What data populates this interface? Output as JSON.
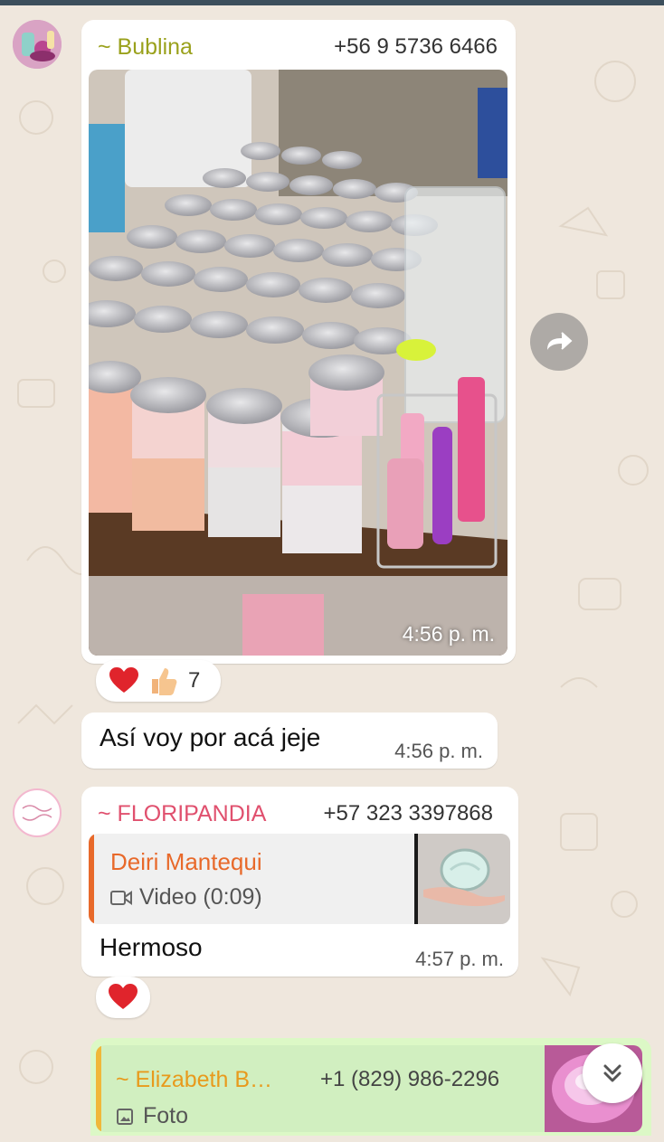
{
  "messages": [
    {
      "sender": "~ Bublina",
      "phone": "+56 9 5736 6466",
      "time": "4:56 p. m.",
      "reaction_count": "7"
    },
    {
      "text": "Así voy por acá jeje",
      "time": "4:56 p. m."
    },
    {
      "sender": "~ FLORIPANDIA",
      "phone": "+57 323 3397868",
      "quote_name": "Deiri Mantequi",
      "quote_text": "Video (0:09)",
      "text": "Hermoso",
      "time": "4:57 p. m."
    },
    {
      "quote_name": "~ Elizabeth B…",
      "quote_phone": "+1 (829) 986-2296",
      "quote_text": "Foto"
    }
  ],
  "avatars": {
    "floripandia_logo": "FloriPandia"
  },
  "colors": {
    "wallpaper": "#efe7dd",
    "bubline_name": "#9aa11c",
    "floripandia_name": "#e0506e",
    "quote_orange": "#e8692a",
    "elizabeth_name": "#e89a1c",
    "outgoing_bubble": "#dcf8c6"
  },
  "icons": [
    "forward-icon",
    "scroll-down-icon",
    "video-icon",
    "photo-icon",
    "heart-icon",
    "thumbs-up-icon"
  ]
}
